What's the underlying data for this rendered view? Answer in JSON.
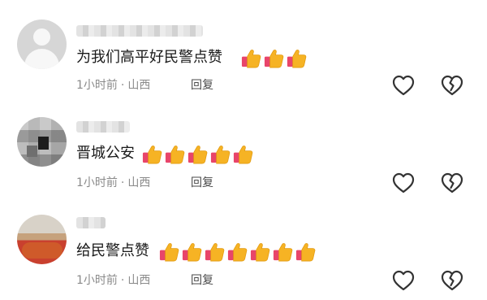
{
  "comments": [
    {
      "text": "为我们高平好民警点赞",
      "thumbs": 3,
      "time": "1小时前",
      "location": "山西",
      "reply_label": "回复"
    },
    {
      "text": "晋城公安",
      "thumbs": 5,
      "time": "1小时前",
      "location": "山西",
      "reply_label": "回复"
    },
    {
      "text": "给民警点赞",
      "thumbs": 7,
      "time": "1小时前",
      "location": "山西",
      "reply_label": "回复"
    }
  ],
  "separator": "·",
  "icons": {
    "like": "heart-outline-icon",
    "dislike": "broken-heart-outline-icon",
    "emoji": "thumbs-up-emoji"
  },
  "colors": {
    "text": "#1a1a1a",
    "meta": "#8a8a8a",
    "reply": "#4a4a4a",
    "icon": "#333333",
    "thumb": "#f6b324",
    "cuff": "#e8456a"
  }
}
